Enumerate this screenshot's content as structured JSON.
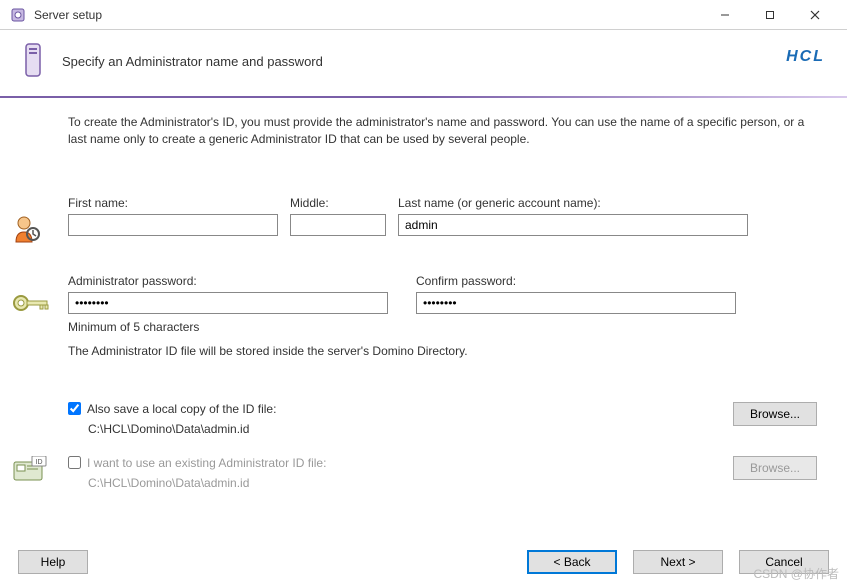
{
  "window": {
    "title": "Server setup"
  },
  "header": {
    "title": "Specify an Administrator name and password",
    "brand": "HCL"
  },
  "intro": "To create the Administrator's ID, you must provide the administrator's name and password. You can use the name of a specific person, or a last name only to create a generic Administrator ID that can be used by several people.",
  "name": {
    "first_label": "First name:",
    "first_value": "",
    "middle_label": "Middle:",
    "middle_value": "",
    "last_label": "Last name (or generic account name):",
    "last_value": "admin"
  },
  "pwd": {
    "label": "Administrator password:",
    "value": "••••••••",
    "confirm_label": "Confirm password:",
    "confirm_value": "••••••••",
    "hint": "Minimum of 5 characters"
  },
  "note": "The Administrator ID file will be stored inside the server's Domino Directory.",
  "optA": {
    "checked": true,
    "label": "Also save a local copy of the ID file:",
    "path": "C:\\HCL\\Domino\\Data\\admin.id",
    "browse": "Browse..."
  },
  "optB": {
    "checked": false,
    "label": "I want to use an existing Administrator ID file:",
    "path": "C:\\HCL\\Domino\\Data\\admin.id",
    "browse": "Browse..."
  },
  "footer": {
    "help": "Help",
    "back": "< Back",
    "next": "Next >",
    "cancel": "Cancel"
  },
  "watermark": "CSDN @协作者"
}
